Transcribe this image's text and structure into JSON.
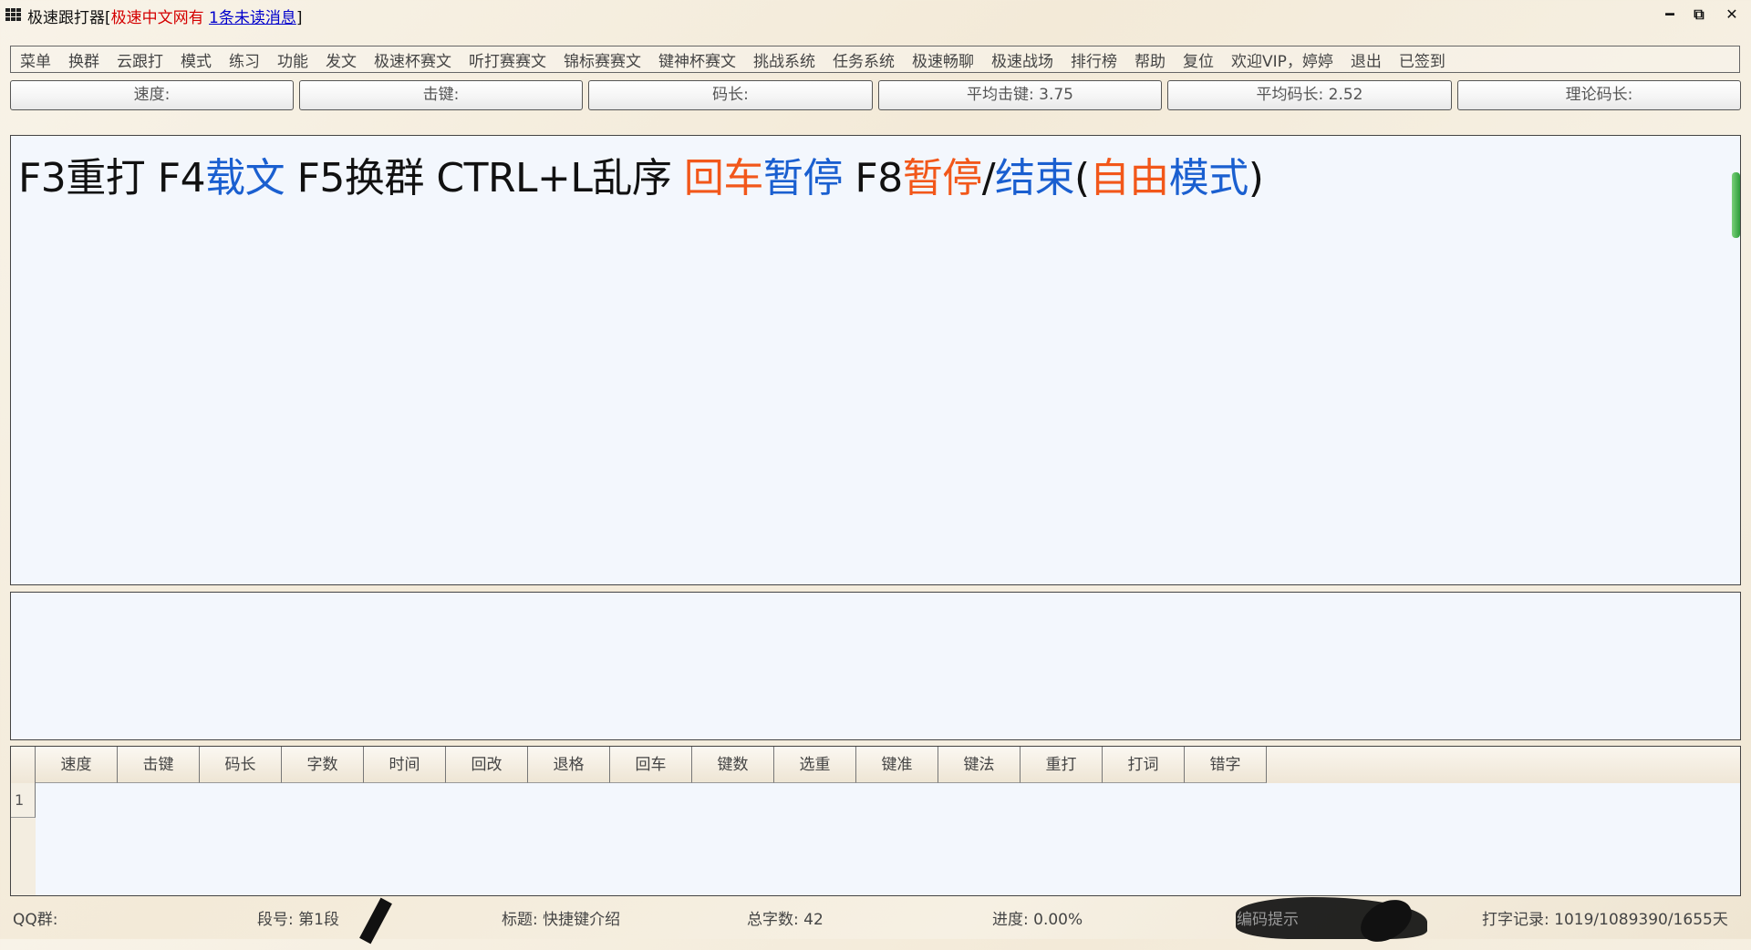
{
  "window": {
    "app_name": "极速跟打器[",
    "site_label": "极速中文网有",
    "unread_link": "1条未读消息",
    "close_bracket": "]",
    "minimize_glyph": "━",
    "restore_glyph": "⧉",
    "close_glyph": "✕"
  },
  "menu": {
    "items": [
      "菜单",
      "换群",
      "云跟打",
      "模式",
      "练习",
      "功能",
      "发文",
      "极速杯赛文",
      "听打赛赛文",
      "锦标赛赛文",
      "键神杯赛文",
      "挑战系统",
      "任务系统",
      "极速畅聊",
      "极速战场",
      "排行榜",
      "帮助",
      "复位",
      "欢迎VIP，婷婷",
      "退出",
      "已签到"
    ]
  },
  "stats": {
    "speed": "速度:",
    "keystroke": "击键:",
    "code_len": "码长:",
    "avg_keystroke": "平均击键: 3.75",
    "avg_code_len": "平均码长: 2.52",
    "theory_code_len": "理论码长:"
  },
  "article": {
    "s1": "F3重打 F4",
    "s2": "载文",
    "s3": " F5换群 CTRL+L乱序 ",
    "s4": "回车",
    "s5": "暂停",
    "s6": " F8",
    "s7": "暂停",
    "s8": "/",
    "s9": "结束",
    "s10": "(",
    "s11": "自由",
    "s12": "模式",
    "s13": ")"
  },
  "results": {
    "columns": [
      "速度",
      "击键",
      "码长",
      "字数",
      "时间",
      "回改",
      "退格",
      "回车",
      "键数",
      "选重",
      "键准",
      "键法",
      "重打",
      "打词",
      "错字"
    ],
    "rows": [
      "1"
    ]
  },
  "status": {
    "qq_group": "QQ群:",
    "segment": "段号: 第1段",
    "title": "标题: 快捷键介绍",
    "total_chars": "总字数: 42",
    "progress": "进度: 0.00%",
    "hint": "编码提示",
    "record": "打字记录: 1019/1089390/1655天"
  },
  "colors": {
    "accent_blue": "#1a5fd0",
    "accent_orange": "#f2571a",
    "panel_bg": "#f3f7fd"
  }
}
